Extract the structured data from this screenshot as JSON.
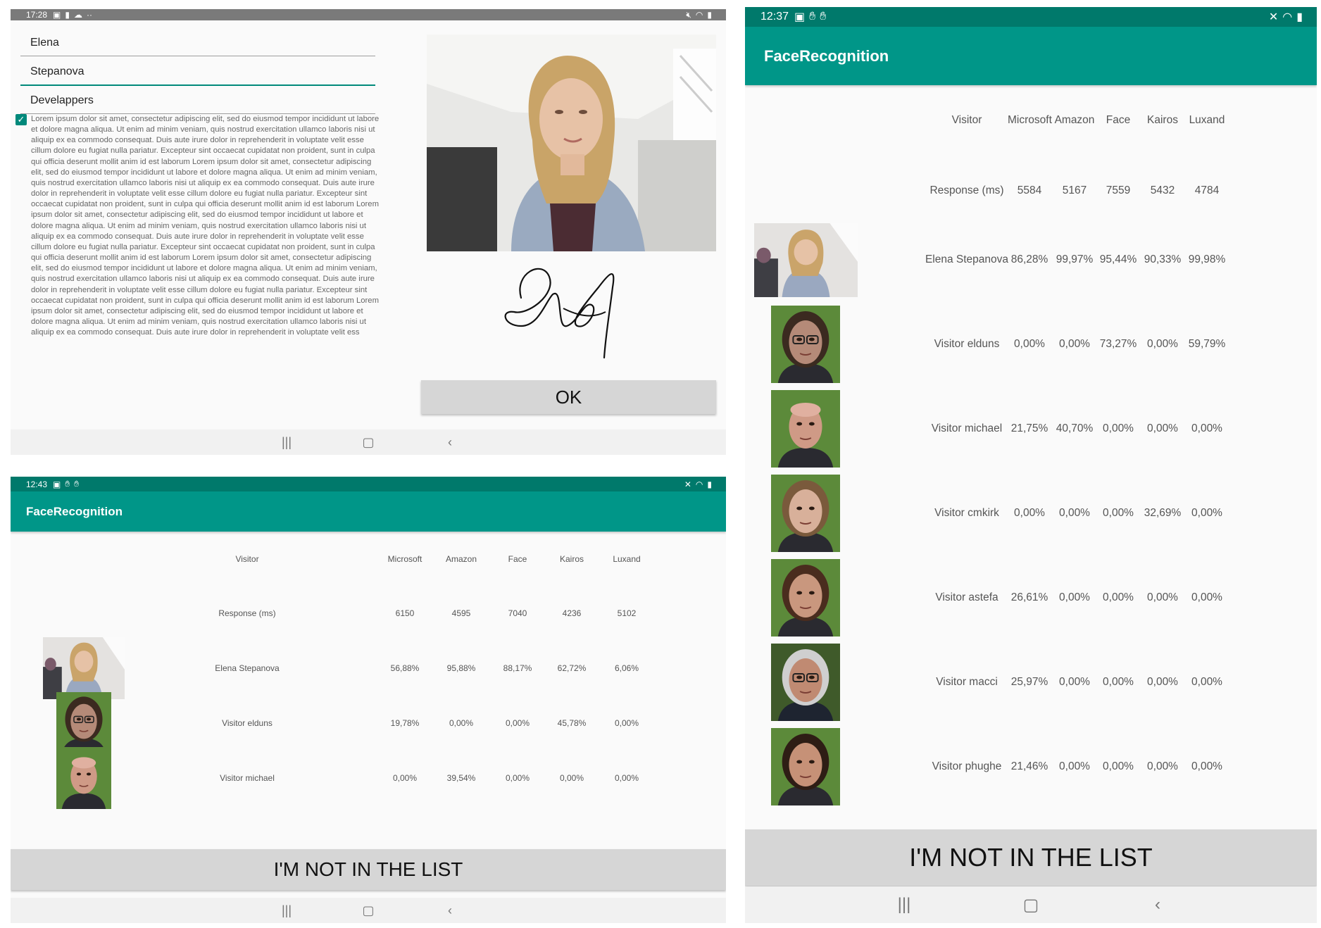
{
  "form_screen": {
    "status": {
      "time": "17:28",
      "left_icons": [
        "image-icon",
        "card-icon",
        "cloud-icon",
        "more-icon"
      ],
      "right_icons": [
        "mute-icon",
        "wifi-icon",
        "battery-icon"
      ]
    },
    "fields": {
      "first_name": "Elena",
      "last_name": "Stepanova",
      "company": "Develappers"
    },
    "consent_checked": true,
    "consent_text": "Lorem ipsum dolor sit amet, consectetur adipiscing elit, sed do eiusmod tempor incididunt ut labore et dolore magna aliqua. Ut enim ad minim veniam, quis nostrud exercitation ullamco laboris nisi ut aliquip ex ea commodo consequat. Duis aute irure dolor in reprehenderit in voluptate velit esse cillum dolore eu fugiat nulla pariatur. Excepteur sint occaecat cupidatat non proident, sunt in culpa qui officia deserunt mollit anim id est laborum Lorem ipsum dolor sit amet, consectetur adipiscing elit, sed do eiusmod tempor incididunt ut labore et dolore magna aliqua. Ut enim ad minim veniam, quis nostrud exercitation ullamco laboris nisi ut aliquip ex ea commodo consequat. Duis aute irure dolor in reprehenderit in voluptate velit esse cillum dolore eu fugiat nulla pariatur. Excepteur sint occaecat cupidatat non proident, sunt in culpa qui officia deserunt mollit anim id est laborum Lorem ipsum dolor sit amet, consectetur adipiscing elit, sed do eiusmod tempor incididunt ut labore et dolore magna aliqua. Ut enim ad minim veniam, quis nostrud exercitation ullamco laboris nisi ut aliquip ex ea commodo consequat. Duis aute irure dolor in reprehenderit in voluptate velit esse cillum dolore eu fugiat nulla pariatur. Excepteur sint occaecat cupidatat non proident, sunt in culpa qui officia deserunt mollit anim id est laborum Lorem ipsum dolor sit amet, consectetur adipiscing elit, sed do eiusmod tempor incididunt ut labore et dolore magna aliqua. Ut enim ad minim veniam, quis nostrud exercitation ullamco laboris nisi ut aliquip ex ea commodo consequat. Duis aute irure dolor in reprehenderit in voluptate velit esse cillum dolore eu fugiat nulla pariatur. Excepteur sint occaecat cupidatat non proident, sunt in culpa qui officia deserunt mollit anim id est laborum Lorem ipsum dolor sit amet, consectetur adipiscing elit, sed do eiusmod tempor incididunt ut labore et dolore magna aliqua. Ut enim ad minim veniam, quis nostrud exercitation ullamco laboris nisi ut aliquip ex ea commodo consequat. Duis aute irure dolor in reprehenderit in voluptate velit ess",
    "ok_label": "OK",
    "nav_icons": [
      "recents-icon",
      "home-icon",
      "back-icon"
    ]
  },
  "results_small": {
    "status": {
      "time": "12:43",
      "left_icons": [
        "image-icon",
        "hand-icon",
        "hand-icon"
      ],
      "right_icons": [
        "mute-icon",
        "wifi-icon",
        "battery-icon"
      ]
    },
    "title": "FaceRecognition",
    "headers": [
      "Visitor",
      "Microsoft",
      "Amazon",
      "Face",
      "Kairos",
      "Luxand"
    ],
    "response": {
      "label": "Response (ms)",
      "values": [
        "6150",
        "4595",
        "7040",
        "4236",
        "5102"
      ]
    },
    "rows": [
      {
        "name": "Elena Stepanova",
        "values": [
          "56,88%",
          "95,88%",
          "88,17%",
          "62,72%",
          "6,06%"
        ],
        "photo": "elena"
      },
      {
        "name": "Visitor elduns",
        "values": [
          "19,78%",
          "0,00%",
          "0,00%",
          "45,78%",
          "0,00%"
        ],
        "photo": "elduns"
      },
      {
        "name": "Visitor michael",
        "values": [
          "0,00%",
          "39,54%",
          "0,00%",
          "0,00%",
          "0,00%"
        ],
        "photo": "michael"
      }
    ],
    "button_label": "I'M NOT IN THE LIST"
  },
  "results_large": {
    "status": {
      "time": "12:37",
      "left_icons": [
        "image-icon",
        "hand-icon",
        "hand-icon"
      ],
      "right_icons": [
        "mute-icon",
        "wifi-icon",
        "battery-icon"
      ]
    },
    "title": "FaceRecognition",
    "headers": [
      "Visitor",
      "Microsoft",
      "Amazon",
      "Face",
      "Kairos",
      "Luxand"
    ],
    "response": {
      "label": "Response (ms)",
      "values": [
        "5584",
        "5167",
        "7559",
        "5432",
        "4784"
      ]
    },
    "rows": [
      {
        "name": "Elena Stepanova",
        "values": [
          "86,28%",
          "99,97%",
          "95,44%",
          "90,33%",
          "99,98%"
        ],
        "photo": "elena"
      },
      {
        "name": "Visitor elduns",
        "values": [
          "0,00%",
          "0,00%",
          "73,27%",
          "0,00%",
          "59,79%"
        ],
        "photo": "elduns"
      },
      {
        "name": "Visitor michael",
        "values": [
          "21,75%",
          "40,70%",
          "0,00%",
          "0,00%",
          "0,00%"
        ],
        "photo": "michael"
      },
      {
        "name": "Visitor cmkirk",
        "values": [
          "0,00%",
          "0,00%",
          "0,00%",
          "32,69%",
          "0,00%"
        ],
        "photo": "cmkirk"
      },
      {
        "name": "Visitor astefa",
        "values": [
          "26,61%",
          "0,00%",
          "0,00%",
          "0,00%",
          "0,00%"
        ],
        "photo": "astefa"
      },
      {
        "name": "Visitor macci",
        "values": [
          "25,97%",
          "0,00%",
          "0,00%",
          "0,00%",
          "0,00%"
        ],
        "photo": "macci"
      },
      {
        "name": "Visitor phughe",
        "values": [
          "21,46%",
          "0,00%",
          "0,00%",
          "0,00%",
          "0,00%"
        ],
        "photo": "phughe"
      }
    ],
    "button_label": "I'M NOT IN THE LIST"
  },
  "colors": {
    "status_gray": "#7a7a7a",
    "status_teal": "#00796b",
    "appbar_teal": "#009688",
    "accent": "#00897b",
    "button_gray": "#d6d6d6"
  }
}
